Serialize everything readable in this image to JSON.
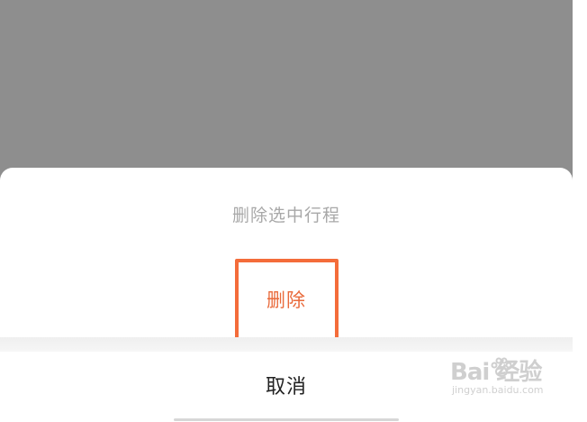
{
  "sheet": {
    "title": "删除选中行程",
    "delete_label": "删除",
    "cancel_label": "取消"
  },
  "watermark": {
    "brand_text": "Bai 经验",
    "url": "jingyan.baidu.com"
  },
  "colors": {
    "overlay": "#8e8e8e",
    "delete_text": "#e96a3b",
    "highlight_border": "#f46c3a",
    "title_text": "#a8a8a8",
    "cancel_text": "#222222"
  }
}
